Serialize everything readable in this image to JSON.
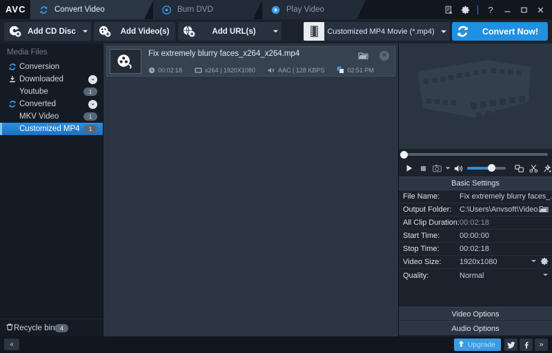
{
  "app": {
    "logo": "AVC"
  },
  "tabs": [
    {
      "label": "Convert Video",
      "icon": "refresh-icon",
      "active": true
    },
    {
      "label": "Burn DVD",
      "icon": "disc-icon",
      "active": false
    },
    {
      "label": "Play Video",
      "icon": "play-circle-icon",
      "active": false
    }
  ],
  "window_controls": {
    "log": "log-icon",
    "settings": "gear-icon",
    "help": "?",
    "minimize": "—",
    "maximize": "□",
    "close": "✕"
  },
  "toolbar": {
    "add_cd_disc": "Add CD Disc",
    "add_videos": "Add Video(s)",
    "add_urls": "Add URL(s)",
    "profile": "Customized MP4 Movie (*.mp4)",
    "convert": "Convert Now!"
  },
  "sidebar": {
    "title": "Media Files",
    "items": [
      {
        "label": "Conversion",
        "icon": "conversion-icon",
        "level": 0,
        "badge": "",
        "chevron": false,
        "selected": false
      },
      {
        "label": "Downloaded",
        "icon": "download-icon",
        "level": 0,
        "badge": "",
        "chevron": true,
        "selected": false
      },
      {
        "label": "Youtube",
        "icon": "",
        "level": 1,
        "badge": "1",
        "chevron": false,
        "selected": false
      },
      {
        "label": "Converted",
        "icon": "refresh-icon",
        "level": 0,
        "badge": "",
        "chevron": true,
        "selected": false
      },
      {
        "label": "MKV Video",
        "icon": "",
        "level": 1,
        "badge": "1",
        "chevron": false,
        "selected": false
      },
      {
        "label": "Customized MP4",
        "icon": "",
        "level": 1,
        "badge": "1",
        "chevron": false,
        "selected": true
      }
    ],
    "recycle_bin": {
      "label": "Recycle bin",
      "badge": "4"
    }
  },
  "file_list": {
    "items": [
      {
        "name": "Fix extremely blurry faces_x264_x264.mp4",
        "duration": "00:02:18",
        "video": "x264 | 1920X1080",
        "audio": "AAC | 128 KBPS",
        "time": "02:51 PM"
      }
    ]
  },
  "player": {
    "play": "play-icon",
    "stop": "stop-icon",
    "snapshot": "camera-icon",
    "volume": "volume-icon",
    "merge": "merge-icon",
    "trim": "scissors-icon",
    "effect": "effects-icon"
  },
  "settings_panel": {
    "title": "Basic Settings",
    "rows": [
      {
        "label": "File Name:",
        "value": "Fix extremely blurry faces_...",
        "dim": false,
        "folder": false,
        "caret": false,
        "gear": false
      },
      {
        "label": "Output Folder:",
        "value": "C:\\Users\\Anvsoft\\Video...",
        "dim": false,
        "folder": true,
        "caret": false,
        "gear": false
      },
      {
        "label": "All Clip Duration:",
        "value": "00:02:18",
        "dim": true,
        "folder": false,
        "caret": false,
        "gear": false
      },
      {
        "label": "Start Time:",
        "value": "00:00:00",
        "dim": false,
        "folder": false,
        "caret": false,
        "gear": false
      },
      {
        "label": "Stop Time:",
        "value": "00:02:18",
        "dim": false,
        "folder": false,
        "caret": false,
        "gear": false
      },
      {
        "label": "Video Size:",
        "value": "1920x1080",
        "dim": false,
        "folder": false,
        "caret": true,
        "gear": true
      },
      {
        "label": "Quality:",
        "value": "Normal",
        "dim": false,
        "folder": false,
        "caret": true,
        "gear": false
      }
    ],
    "video_options": "Video Options",
    "audio_options": "Audio Options"
  },
  "status_bar": {
    "collapse": "«",
    "upgrade": "Upgrade",
    "twitter": "twitter-icon",
    "facebook": "facebook-icon",
    "more": "»"
  },
  "colors": {
    "accent": "#2090e0",
    "panel": "#1b222c",
    "titlebar": "#12171f",
    "filelist": "#2b3443",
    "selected": "#2a8fe0"
  }
}
